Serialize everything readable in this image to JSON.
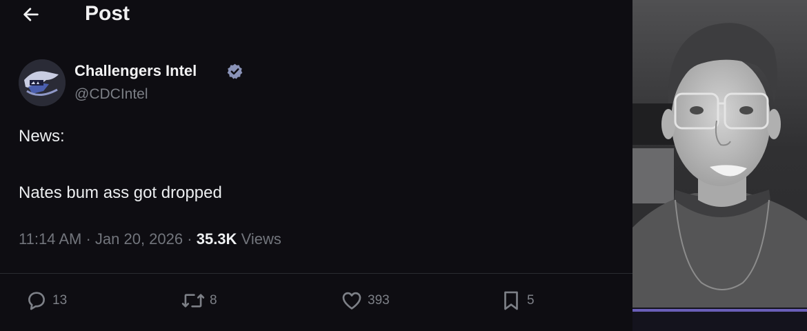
{
  "header": {
    "title": "Post",
    "back_icon": "arrow-left-icon"
  },
  "author": {
    "name": "Challengers Intel",
    "handle": "@CDCIntel",
    "verified_icon": "verified-badge-icon",
    "verified_color": "#8a93b8"
  },
  "post": {
    "line1": "News:",
    "line2": "Nates bum ass got dropped"
  },
  "meta": {
    "time": "11:14 AM",
    "separator": "·",
    "date": "Jan 20, 2026",
    "views_count": "35.3K",
    "views_label": "Views"
  },
  "actions": {
    "reply": {
      "icon": "reply-icon",
      "count": "13"
    },
    "repost": {
      "icon": "repost-icon",
      "count": "8"
    },
    "like": {
      "icon": "heart-icon",
      "count": "393"
    },
    "bookmark": {
      "icon": "bookmark-icon",
      "count": "5"
    }
  },
  "colors": {
    "background": "#0e0d12",
    "text": "#e7e9ea",
    "muted": "#72757c",
    "accent_bar": "#6a5fb8"
  }
}
